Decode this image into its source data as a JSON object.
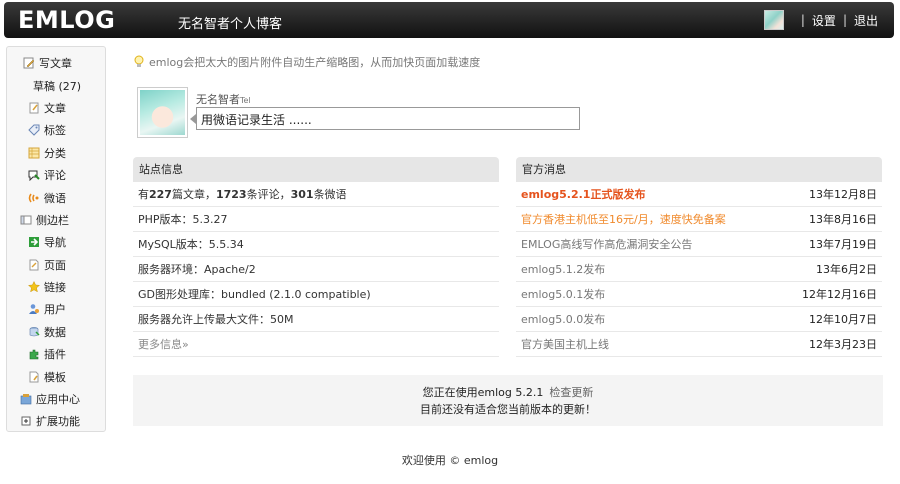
{
  "header": {
    "logo": "EMLOG",
    "blog_name": "无名智者个人博客",
    "settings": "设置",
    "logout": "退出",
    "sep": "|"
  },
  "sidebar": {
    "items": [
      {
        "label": "写文章",
        "icon": "write-icon"
      },
      {
        "label": "草稿 (27)",
        "icon": ""
      },
      {
        "label": "文章",
        "icon": "article-icon"
      },
      {
        "label": "标签",
        "icon": "tag-icon"
      },
      {
        "label": "分类",
        "icon": "category-icon"
      },
      {
        "label": "评论",
        "icon": "comment-icon"
      },
      {
        "label": "微语",
        "icon": "weibo-icon"
      },
      {
        "label": "侧边栏",
        "icon": "sidebar-icon"
      },
      {
        "label": "导航",
        "icon": "navi-icon"
      },
      {
        "label": "页面",
        "icon": "page-icon"
      },
      {
        "label": "链接",
        "icon": "link-icon"
      },
      {
        "label": "用户",
        "icon": "user-icon"
      },
      {
        "label": "数据",
        "icon": "data-icon"
      },
      {
        "label": "插件",
        "icon": "plugin-icon"
      },
      {
        "label": "模板",
        "icon": "template-icon"
      },
      {
        "label": "应用中心",
        "icon": "app-center-icon"
      },
      {
        "label": "扩展功能",
        "icon": "expand-icon"
      }
    ]
  },
  "tip": "emlog会把太大的图片附件自动生产缩略图，从而加快页面加载速度",
  "twitter": {
    "name": "无名智者",
    "name_suffix": "Tel",
    "input_value": "用微语记录生活 ......"
  },
  "site_info": {
    "title": "站点信息",
    "stats": {
      "prefix": "有",
      "posts": "227",
      "posts_unit": "篇文章，",
      "comments": "1723",
      "comments_unit": "条评论，",
      "twitters": "301",
      "twitters_unit": "条微语"
    },
    "rows": [
      "PHP版本：5.3.27",
      "MySQL版本：5.5.34",
      "服务器环境：Apache/2",
      "GD图形处理库：bundled (2.1.0 compatible)",
      "服务器允许上传最大文件：50M"
    ],
    "more": "更多信息»"
  },
  "news": {
    "title": "官方消息",
    "items": [
      {
        "text": "emlog5.2.1正式版发布",
        "date": "13年12月8日",
        "style": "hot"
      },
      {
        "text": "官方香港主机低至16元/月，速度快免备案",
        "date": "13年8月16日",
        "style": "orange"
      },
      {
        "text": "EMLOG高线写作高危漏洞安全公告",
        "date": "13年7月19日",
        "style": "normal"
      },
      {
        "text": "emlog5.1.2发布",
        "date": "13年6月2日",
        "style": "normal"
      },
      {
        "text": "emlog5.0.1发布",
        "date": "12年12月16日",
        "style": "normal"
      },
      {
        "text": "emlog5.0.0发布",
        "date": "12年10月7日",
        "style": "normal"
      },
      {
        "text": "官方美国主机上线",
        "date": "12年3月23日",
        "style": "normal"
      }
    ]
  },
  "update": {
    "line1": "您正在使用emlog 5.2.1",
    "check": "检查更新",
    "line2": "目前还没有适合您当前版本的更新！"
  },
  "footer": "欢迎使用 © emlog",
  "colors": {
    "hot": "#e5531d",
    "orange": "#f08a2c",
    "header_bg": "#1a1a1a"
  }
}
